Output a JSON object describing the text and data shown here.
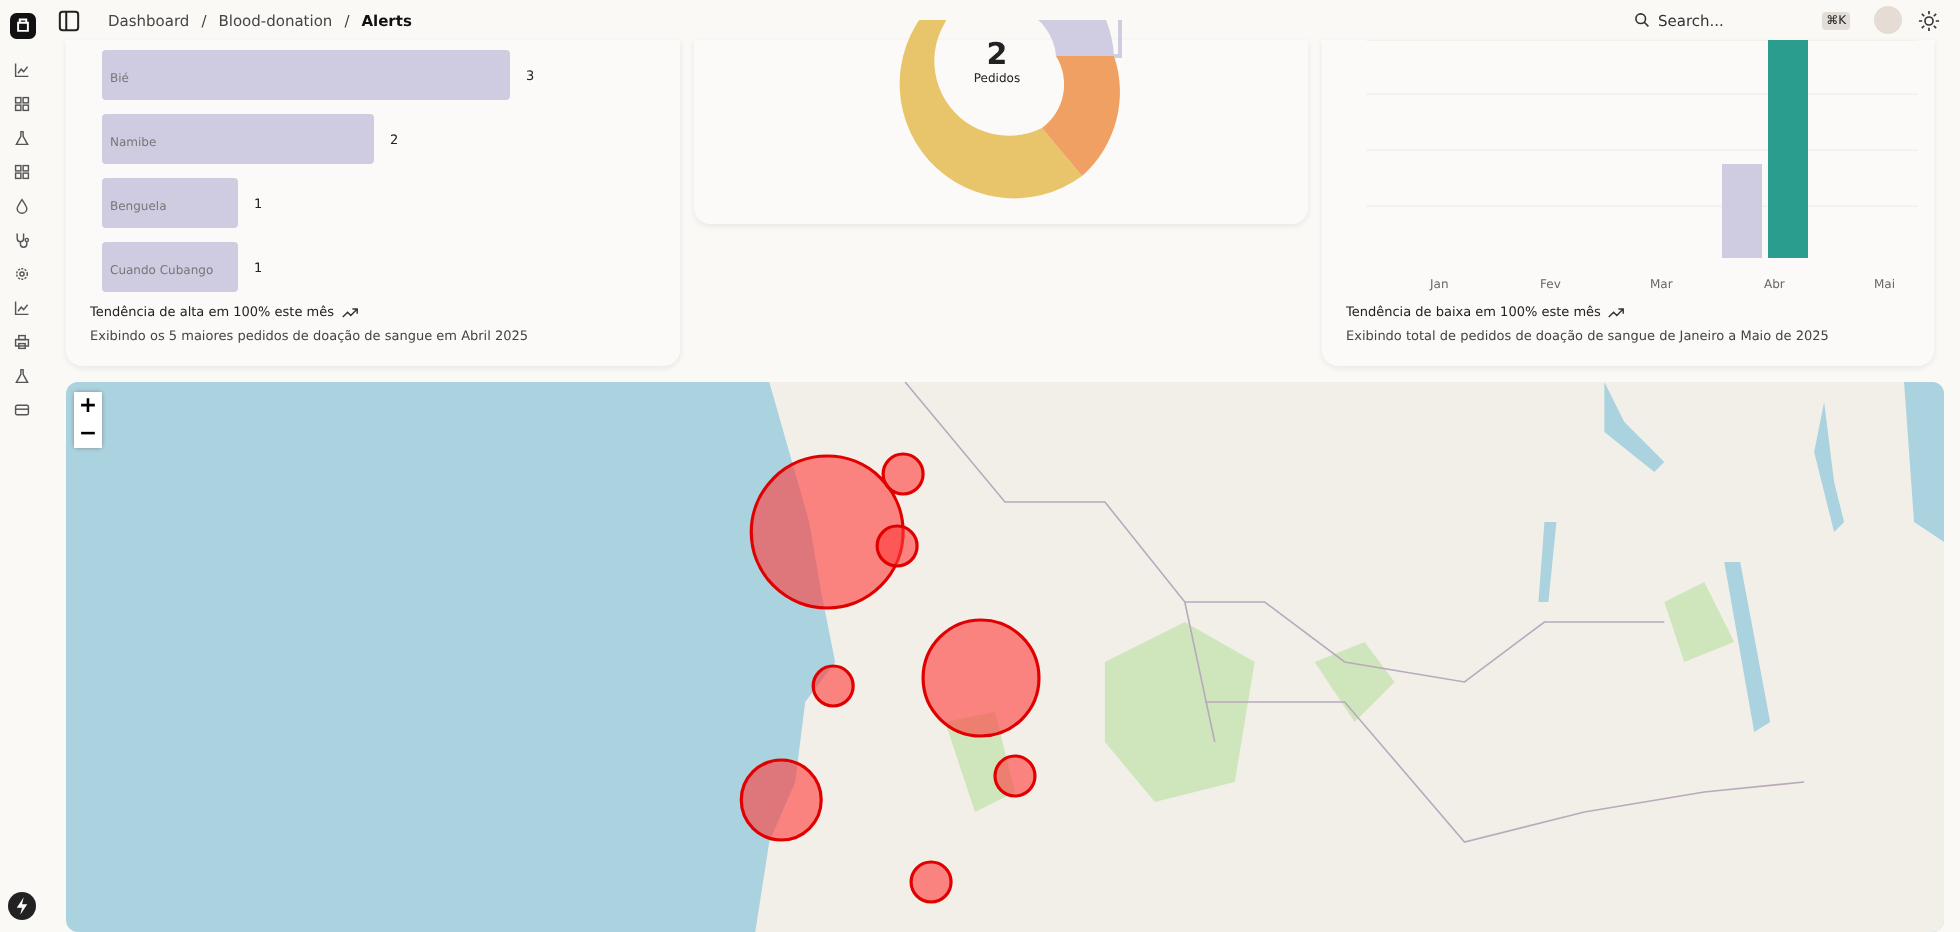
{
  "breadcrumb": [
    {
      "label": "Dashboard",
      "current": false
    },
    {
      "label": "Blood-donation",
      "current": false
    },
    {
      "label": "Alerts",
      "current": true
    }
  ],
  "breadcrumb_separator": "/",
  "search": {
    "placeholder": "Search...",
    "shortcut": "⌘K"
  },
  "top_regions_card": {
    "chart_data": {
      "type": "bar",
      "orientation": "horizontal",
      "categories": [
        "Bié",
        "Namibe",
        "Benguela",
        "Cuando Cubango"
      ],
      "values": [
        3,
        2,
        1,
        1
      ],
      "data_labels": true
    },
    "trend": "Tendência de alta em 100% este mês",
    "caption": "Exibindo os 5 maiores pedidos de doação de sangue em Abril 2025"
  },
  "donut_card": {
    "total": "2",
    "total_label": "Pedidos"
  },
  "monthly_card": {
    "month_labels": [
      "Jan",
      "Fev",
      "Mar",
      "Abr",
      "Mai"
    ],
    "trend": "Tendência de baixa em 100% este mês",
    "caption": "Exibindo total de pedidos de doação de sangue de Janeiro a Maio de 2025"
  },
  "map": {
    "zoom_in": "+",
    "zoom_out": "−"
  }
}
